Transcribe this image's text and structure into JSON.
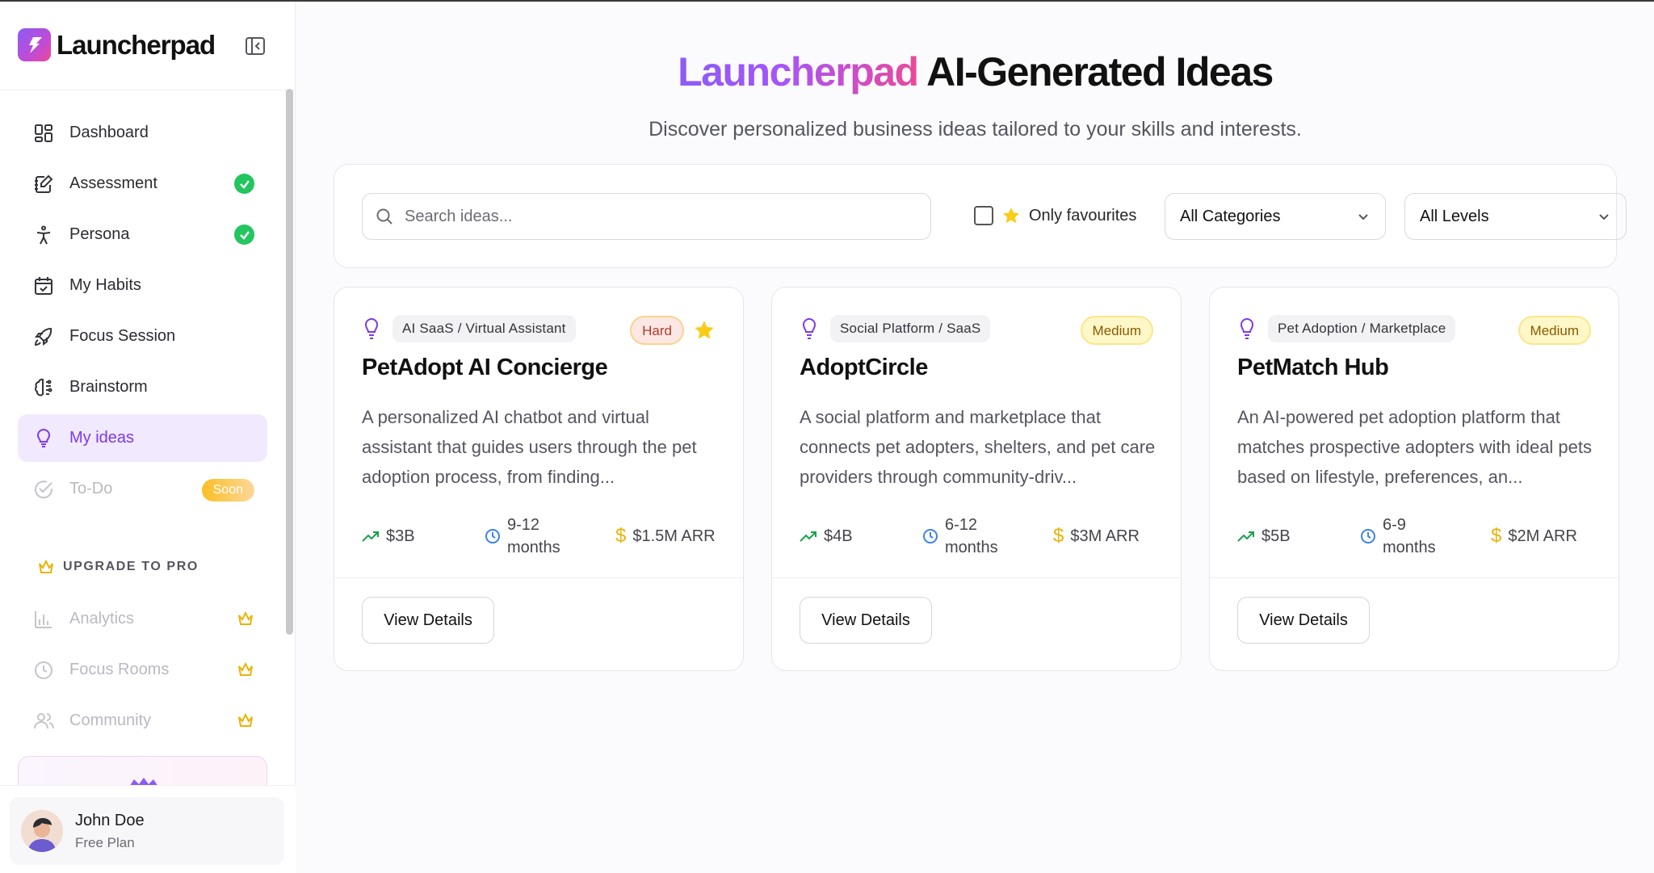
{
  "app": {
    "name": "Launcherpad"
  },
  "sidebar": {
    "items": [
      {
        "label": "Dashboard",
        "icon": "dashboard-icon"
      },
      {
        "label": "Assessment",
        "icon": "assessment-icon",
        "badge": "check"
      },
      {
        "label": "Persona",
        "icon": "persona-icon",
        "badge": "check"
      },
      {
        "label": "My Habits",
        "icon": "calendar-icon"
      },
      {
        "label": "Focus Session",
        "icon": "rocket-icon"
      },
      {
        "label": "Brainstorm",
        "icon": "brain-icon"
      },
      {
        "label": "My ideas",
        "icon": "lightbulb-icon",
        "active": true
      },
      {
        "label": "To-Do",
        "icon": "check-circle-icon",
        "badge": "Soon",
        "disabled": true
      }
    ],
    "upgrade": {
      "title": "UPGRADE TO PRO",
      "items": [
        {
          "label": "Analytics",
          "icon": "bar-chart-icon"
        },
        {
          "label": "Focus Rooms",
          "icon": "clock-icon"
        },
        {
          "label": "Community",
          "icon": "users-icon"
        }
      ]
    },
    "user": {
      "name": "John Doe",
      "plan": "Free Plan"
    }
  },
  "header": {
    "title_brand": "Launcherpad",
    "title_rest": " AI-Generated Ideas",
    "subtitle": "Discover personalized business ideas tailored to your skills and interests."
  },
  "filters": {
    "search_placeholder": "Search ideas...",
    "favourites_label": "Only favourites",
    "category": "All Categories",
    "level": "All Levels"
  },
  "cards": [
    {
      "category": "AI SaaS / Virtual Assistant",
      "difficulty": "Hard",
      "favourite": true,
      "title": "PetAdopt AI Concierge",
      "description": "A personalized AI chatbot and virtual assistant that guides users through the pet adoption process, from finding...",
      "market": "$3B",
      "timeline_line1": "9-12",
      "timeline_line2": "months",
      "revenue": "$1.5M ARR",
      "button": "View Details"
    },
    {
      "category": "Social Platform / SaaS",
      "difficulty": "Medium",
      "favourite": false,
      "title": "AdoptCircle",
      "description": "A social platform and marketplace that connects pet adopters, shelters, and pet care providers through community-driv...",
      "market": "$4B",
      "timeline_line1": "6-12",
      "timeline_line2": "months",
      "revenue": "$3M ARR",
      "button": "View Details"
    },
    {
      "category": "Pet Adoption / Marketplace",
      "difficulty": "Medium",
      "favourite": false,
      "title": "PetMatch Hub",
      "description": "An AI-powered pet adoption platform that matches prospective adopters with ideal pets based on lifestyle, preferences, an...",
      "market": "$5B",
      "timeline_line1": "6-9",
      "timeline_line2": "months",
      "revenue": "$2M ARR",
      "button": "View Details"
    }
  ],
  "colors": {
    "accent": "#7c3aed",
    "active_bg": "#f1e9fd",
    "success": "#22c55e",
    "gold": "#eab308",
    "trend": "#16a34a",
    "clock": "#3b82f6"
  }
}
